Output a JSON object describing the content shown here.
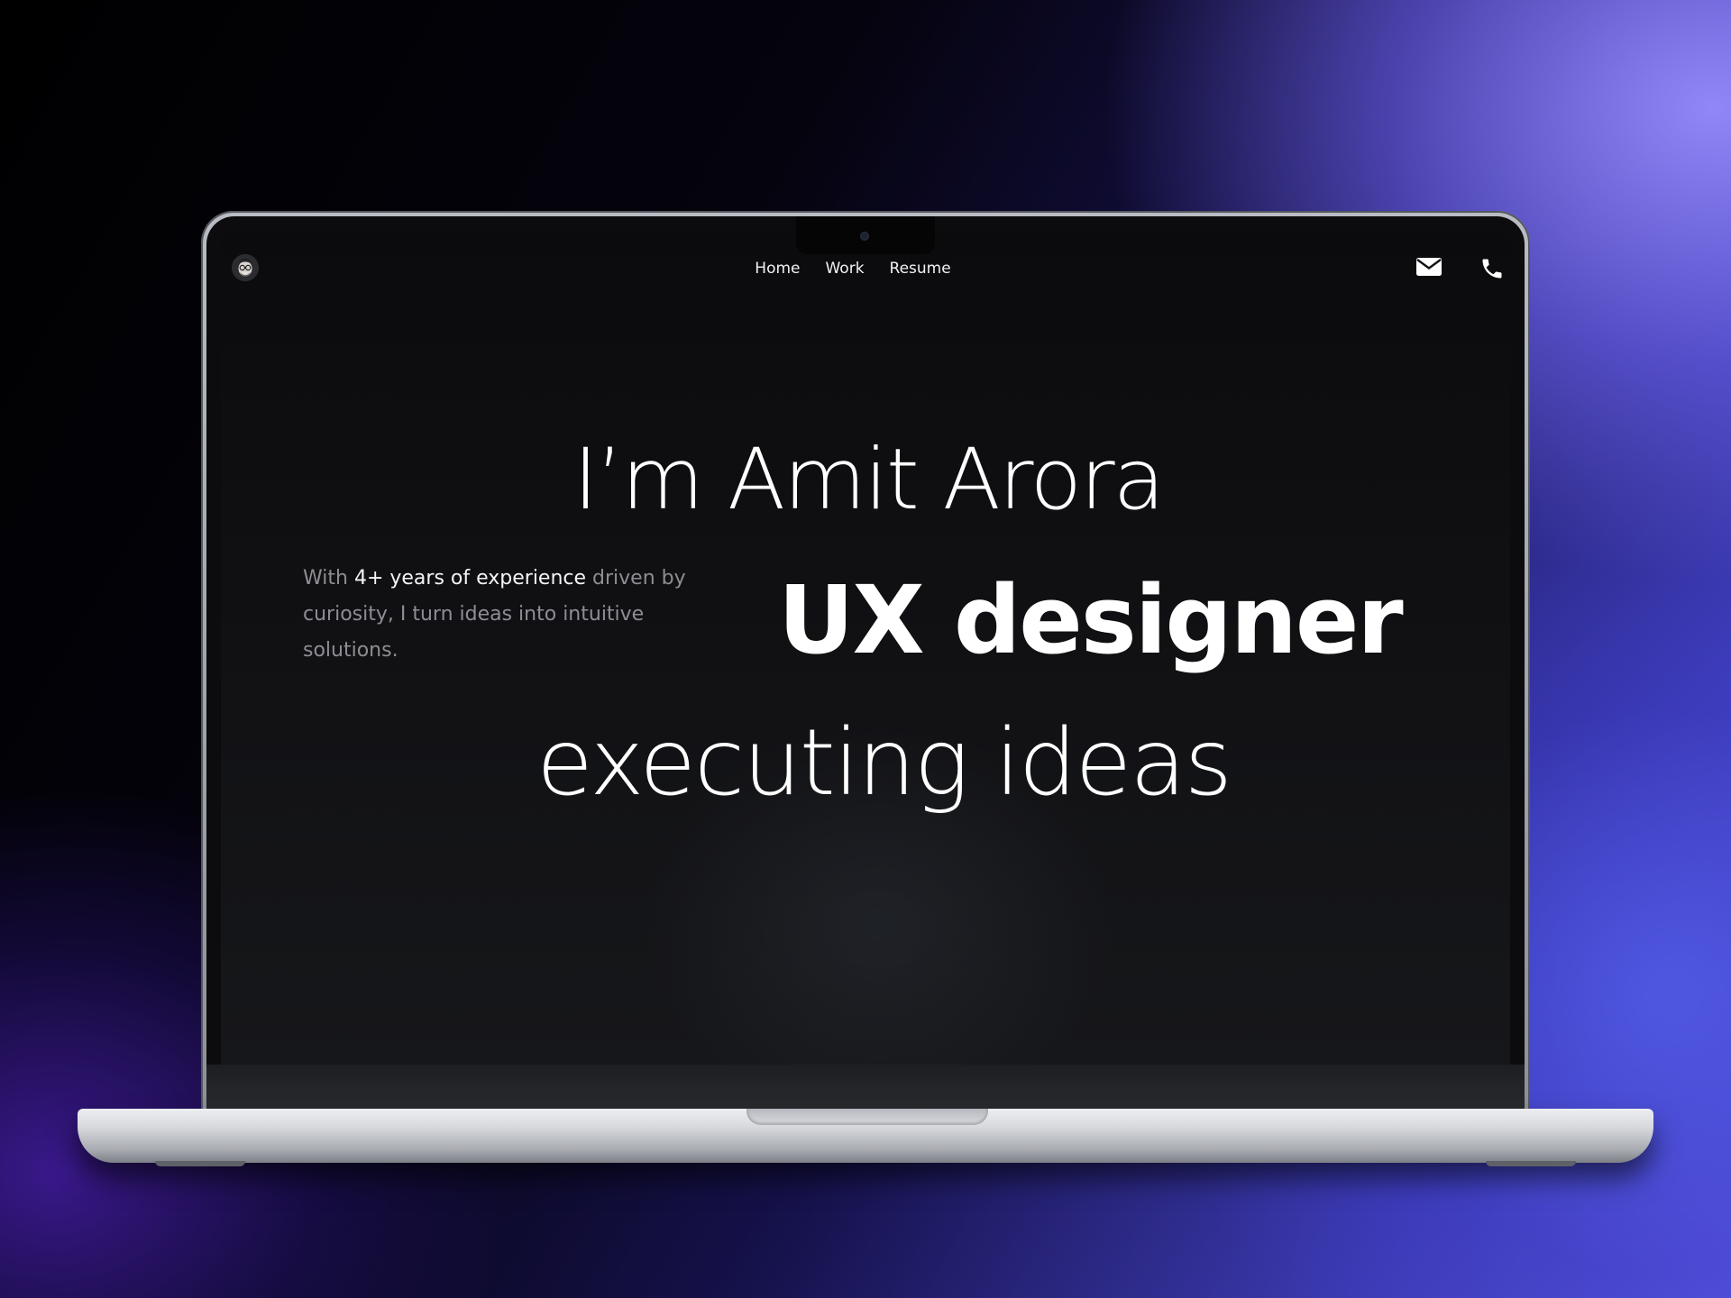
{
  "nav": {
    "items": [
      {
        "label": "Home"
      },
      {
        "label": "Work"
      },
      {
        "label": "Resume"
      }
    ]
  },
  "hero": {
    "line1": "I’m Amit Arora",
    "line2": "UX designer",
    "line3": "executing ideas"
  },
  "intro": {
    "prefix": "With ",
    "highlight": "4+ years of experience",
    "suffix": " driven by curiosity, I turn ideas into intuitive solutions."
  },
  "icons": {
    "avatar": "memoji-avatar-icon",
    "mail": "mail-icon",
    "phone": "phone-icon"
  },
  "colors": {
    "screen_background": "#111114",
    "text_primary": "#ffffff",
    "text_muted": "#8d8e93",
    "backdrop_accent": "#6b63f0"
  }
}
